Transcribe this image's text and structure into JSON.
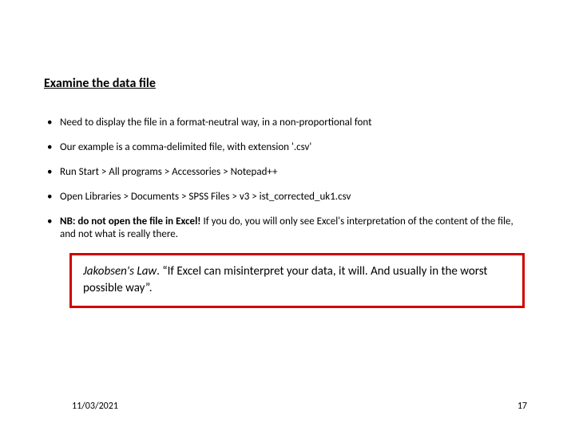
{
  "title": "Examine the data file",
  "bullets": {
    "b1": "Need to display the file in a format-neutral way, in a non-proportional font",
    "b2": "Our example is a comma-delimited file, with extension '.csv'",
    "b3": "Run Start > All programs > Accessories > Notepad++",
    "b4": "Open Libraries > Documents > SPSS Files > v3 > ist_corrected_uk1.csv",
    "b5_bold": "NB: do not open the file in Excel!",
    "b5_rest": " If you do, you will only see Excel's interpretation of the content of the file, and not what is really there."
  },
  "callout": {
    "law_label": "Jakobsen's Law",
    "law_text": ". “If Excel can misinterpret your data, it will. And usually in the worst possible way”."
  },
  "footer": {
    "date": "11/03/2021",
    "page": "17"
  }
}
